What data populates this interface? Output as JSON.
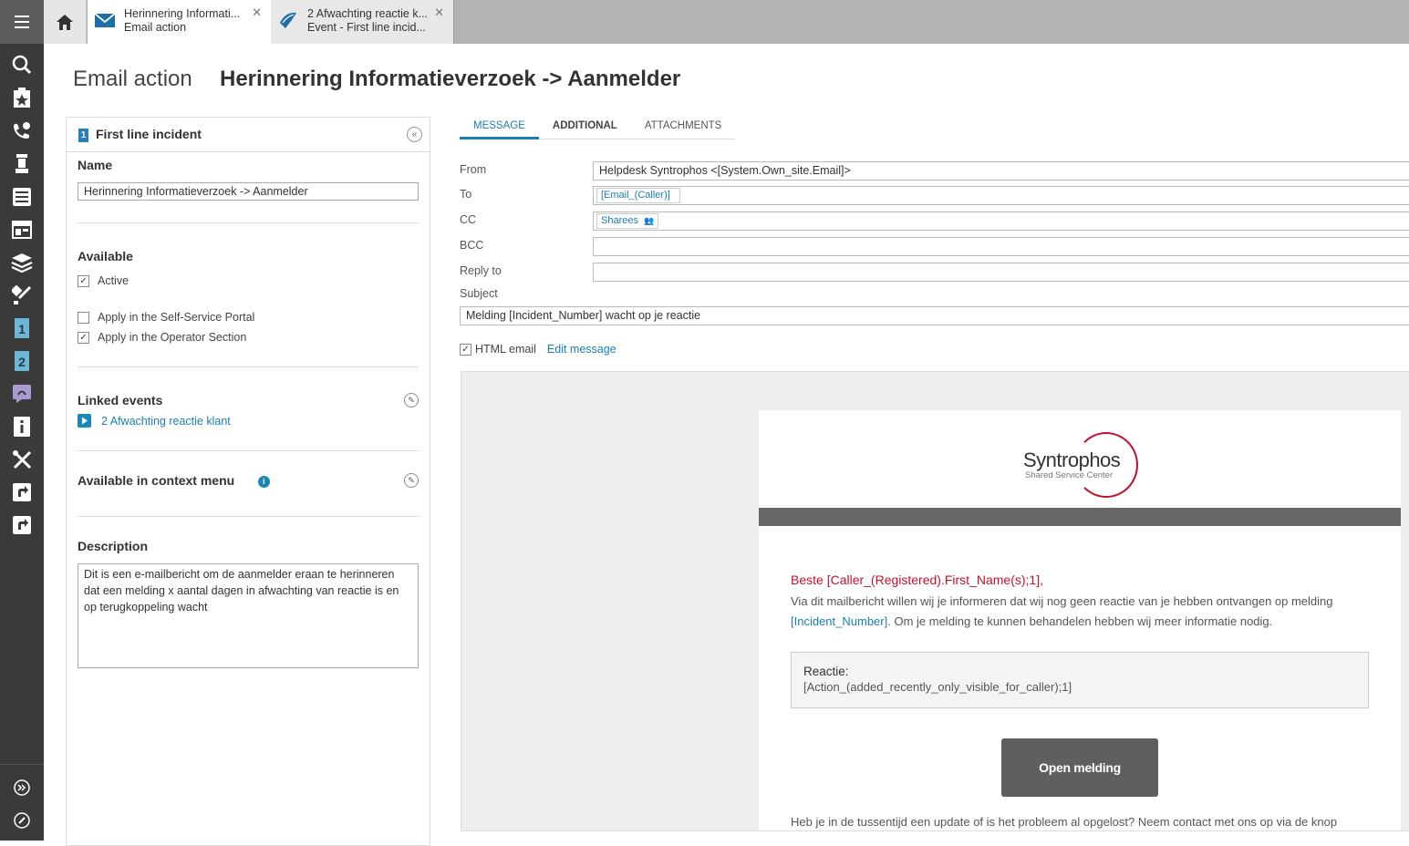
{
  "tabs": [
    {
      "title": "Herinnering Informati...",
      "subtitle": "Email action"
    },
    {
      "title": "2 Afwachting reactie k...",
      "subtitle": "Event -  First line incid..."
    }
  ],
  "title": {
    "type": "Email action",
    "name": "Herinnering Informatieverzoek -> Aanmelder"
  },
  "left_panel": {
    "header": "First line incident",
    "badge": "1",
    "name_label": "Name",
    "name_value": "Herinnering Informatieverzoek -> Aanmelder",
    "available_label": "Available",
    "active_label": "Active",
    "active_checked": true,
    "self_service_label": "Apply in the Self-Service Portal",
    "self_service_checked": false,
    "operator_label": "Apply in the Operator Section",
    "operator_checked": true,
    "linked_events_label": "Linked events",
    "linked_event": "2 Afwachting reactie klant",
    "context_menu_label": "Available in context menu",
    "description_label": "Description",
    "description": "Dit is een e-mailbericht om de aanmelder eraan te herinneren dat een melding x aantal dagen in afwachting van reactie is en op terugkoppeling wacht"
  },
  "message_tabs": [
    "MESSAGE",
    "ADDITIONAL",
    "ATTACHMENTS"
  ],
  "form": {
    "from_label": "From",
    "from_value": "Helpdesk Syntrophos <[System.Own_site.Email]>",
    "to_label": "To",
    "to_token": "[Email_(Caller)]",
    "cc_label": "CC",
    "cc_token": "Sharees",
    "bcc_label": "BCC",
    "reply_label": "Reply to",
    "subject_label": "Subject",
    "subject_value": "Melding [Incident_Number] wacht op je reactie",
    "html_email_label": "HTML email",
    "edit_message_label": "Edit message"
  },
  "preview": {
    "logo_name": "Syntrophos",
    "logo_sub": "Shared Service Center",
    "greeting": "Beste [Caller_(Registered).First_Name(s);1],",
    "intro_1": "Via dit mailbericht willen wij je informeren dat wij nog geen reactie van je hebben ontvangen op melding ",
    "intro_ph": "[Incident_Number]",
    "intro_2": ". Om je melding te kunnen behandelen hebben wij meer informatie nodig.",
    "reactie_title": "Reactie:",
    "reactie_value": "[Action_(added_recently_only_visible_for_caller);1]",
    "button": "Open melding",
    "footer": "Heb je in de tussentijd een update of is het probleem al opgelost? Neem contact met ons op via de knop"
  },
  "colors": {
    "accent": "#1a7fb0",
    "greeting": "#c8102e",
    "rail": "#3a3a3a"
  },
  "rail_icons": [
    "menu-icon",
    "search-icon",
    "star-clipboard-icon",
    "caller-icon",
    "chess-pawn-icon",
    "list-icon",
    "board-icon",
    "layers-icon",
    "brush-icon",
    "first-line-icon",
    "second-line-icon",
    "chat-icon",
    "info-icon",
    "tools-icon",
    "shortcut-icon",
    "shortcut-icon",
    "expand-icon",
    "edit-icon"
  ]
}
